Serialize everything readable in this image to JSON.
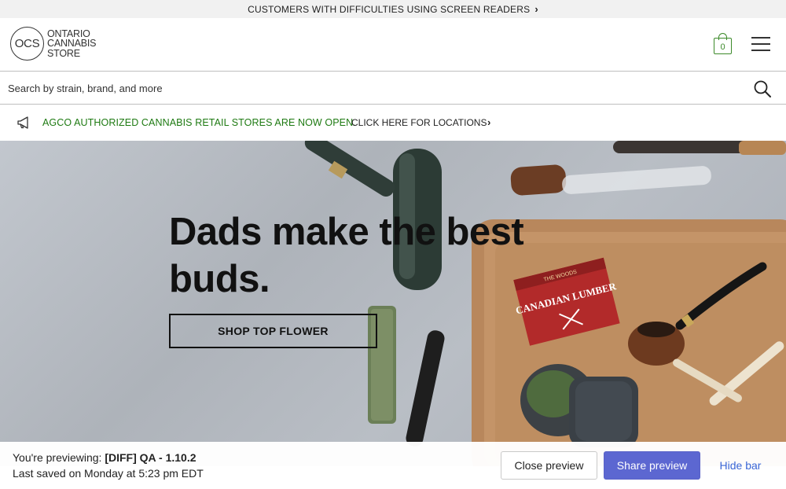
{
  "accessibility_bar": {
    "text": "CUSTOMERS WITH DIFFICULTIES USING SCREEN READERS",
    "chevron": "›"
  },
  "logo": {
    "mark": "OCS",
    "line1": "ONTARIO",
    "line2": "CANNABIS",
    "line3": "STORE"
  },
  "cart": {
    "count": "0",
    "icon": "shopping-bag-icon",
    "color": "#3c8a2a"
  },
  "menu": {
    "icon": "hamburger-menu-icon"
  },
  "search": {
    "placeholder": "Search by strain, brand, and more",
    "value": "",
    "icon": "search-icon"
  },
  "notice": {
    "icon": "megaphone-icon",
    "green_text": "AGCO AUTHORIZED CANNABIS RETAIL STORES ARE NOW OPEN.",
    "link_text": "CLICK HERE FOR LOCATIONS",
    "chevron": "›",
    "color": "#1e7a12"
  },
  "hero": {
    "title": "Dads make the best buds.",
    "cta": "SHOP TOP FLOWER",
    "product_box_text": "CANADIAN LUMBER",
    "product_box_small": "THE WOODS"
  },
  "preview_bar": {
    "previewing_label": "You're previewing:",
    "theme_name": "[DIFF] QA - 1.10.2",
    "saved_text": "Last saved on Monday at 5:23 pm EDT",
    "close_label": "Close preview",
    "share_label": "Share preview",
    "hide_label": "Hide bar",
    "accent": "#5c67d1"
  }
}
